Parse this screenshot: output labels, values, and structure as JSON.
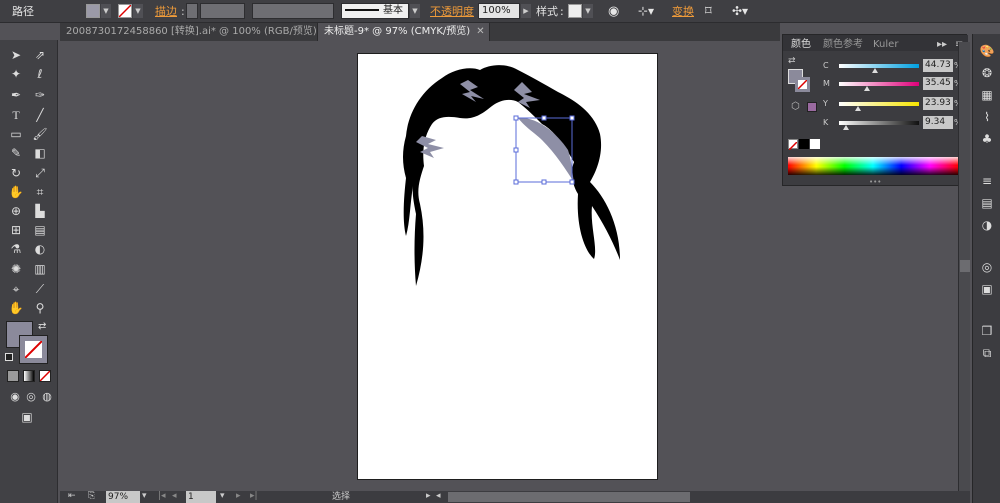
{
  "control_bar": {
    "object_type": "路径",
    "stroke_label": "描边",
    "stroke_style": "基本",
    "opacity_label": "不透明度",
    "opacity_value": "100%",
    "style_label": "样式",
    "transform_label": "变换"
  },
  "tabs": [
    {
      "label": "2008730172458860 [转换].ai* @ 100% (RGB/预览)",
      "active": false
    },
    {
      "label": "未标题-9* @ 97% (CMYK/预览)",
      "active": true
    }
  ],
  "color_panel": {
    "tabs": [
      "颜色",
      "颜色参考",
      "Kuler"
    ],
    "channels": [
      {
        "label": "C",
        "value": "44.73",
        "level": 0.447,
        "gradient": "linear-gradient(to right,#ffffff,#00a0e0)"
      },
      {
        "label": "M",
        "value": "35.45",
        "level": 0.355,
        "gradient": "linear-gradient(to right,#ffffff,#e0007a)"
      },
      {
        "label": "Y",
        "value": "23.93",
        "level": 0.239,
        "gradient": "linear-gradient(to right,#ffffff,#f5e400)"
      },
      {
        "label": "K",
        "value": "9.34",
        "level": 0.093,
        "gradient": "linear-gradient(to right,#ffffff,#111111)"
      }
    ],
    "pct": "%"
  },
  "status_bar": {
    "zoom": "97%",
    "page": "1",
    "tool": "选择"
  },
  "colors": {
    "fill": "#8b8a9b",
    "hair": "#000000",
    "highlight": "#8e8fa6",
    "selection": "#5a6bd8"
  }
}
